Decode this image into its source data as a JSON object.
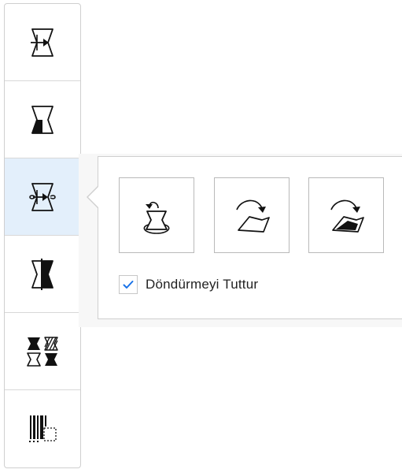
{
  "toolbar": {
    "tools": [
      {
        "icon": "insert-arrow-hourglass-icon"
      },
      {
        "icon": "filled-bottom-hourglass-icon"
      },
      {
        "icon": "rotate-arrow-hourglass-icon",
        "active": true
      },
      {
        "icon": "split-half-hourglass-icon"
      },
      {
        "icon": "hatch-pattern-grid-icon"
      },
      {
        "icon": "barcode-dotted-box-icon"
      }
    ]
  },
  "popover": {
    "options": [
      {
        "icon": "rotate-in-place-icon"
      },
      {
        "icon": "rotate-shape-right-icon"
      },
      {
        "icon": "rotate-filled-shape-right-icon"
      }
    ],
    "checkbox": {
      "label": "Döndürmeyi Tuttur",
      "checked": true
    }
  },
  "colors": {
    "active_bg": "#e3effb",
    "check": "#1a73e8",
    "icon": "#111111"
  }
}
